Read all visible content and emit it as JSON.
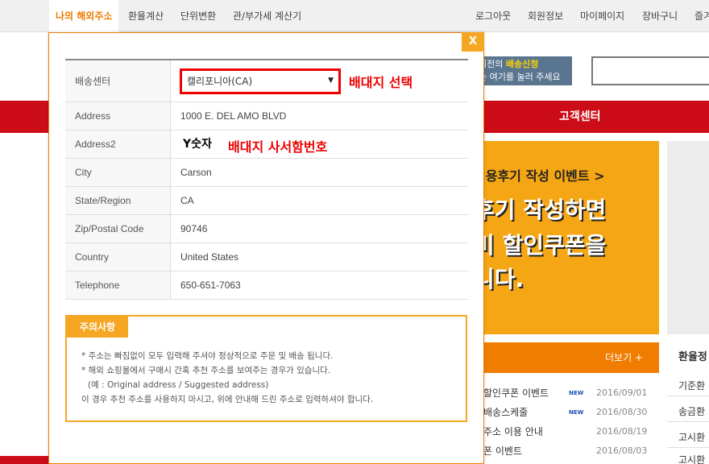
{
  "nav": {
    "items": [
      "나의 해외주소",
      "환율계산",
      "단위변환",
      "관/부가세 계산기"
    ],
    "right": [
      "로그아웃",
      "회원정보",
      "마이페이지",
      "장바구니",
      "즐겨"
    ]
  },
  "background": {
    "prev_order_line1_pre": "이전의 ",
    "prev_order_line1_hl": "배송신청",
    "prev_order_line2": "는 여기를 눌러 주세요",
    "customer_center": "고객센터",
    "banner_title": "이용후기 작성 이벤트 >",
    "banner_big": [
      "후기 작성하면",
      "비 할인쿠폰을",
      "니다."
    ],
    "more": "더보기 +",
    "rate_title": "환율정",
    "news": [
      {
        "title": "할인쿠폰 이벤트",
        "new": "NEW",
        "date": "2016/09/01"
      },
      {
        "title": "배송스케줄",
        "new": "NEW",
        "date": "2016/08/30"
      },
      {
        "title": "주소 이용 안내",
        "new": "",
        "date": "2016/08/19"
      },
      {
        "title": "폰 이벤트",
        "new": "",
        "date": "2016/08/03"
      }
    ],
    "rates": [
      "기준환",
      "송금환",
      "고시환",
      "고시환"
    ]
  },
  "modal": {
    "close_label": "X",
    "fields": [
      {
        "label": "배송센터",
        "value": "캘리포니아(CA)"
      },
      {
        "label": "Address",
        "value": "1000 E. DEL AMO BLVD"
      },
      {
        "label": "Address2",
        "value": "Y숫자"
      },
      {
        "label": "City",
        "value": "Carson"
      },
      {
        "label": "State/Region",
        "value": "CA"
      },
      {
        "label": "Zip/Postal Code",
        "value": "90746"
      },
      {
        "label": "Country",
        "value": "United States"
      },
      {
        "label": "Telephone",
        "value": "650-651-7063"
      }
    ],
    "select_note": "배대지 선택",
    "pobox_note": "배대지 사서함번호",
    "caution": {
      "title": "주의사항",
      "lines": [
        "* 주소는 빠짐없이 모두 입력해 주셔야 정상적으로 주문 및 배송 됩니다.",
        "* 해외 쇼핑몰에서 구매시 간혹 추천 주소를 보여주는 경우가 있습니다.",
        "(예 : Original address / Suggested address)",
        "이 경우 추천 주소를 사용하지 마시고, 위에 안내해 드린 주소로 입력하셔야 합니다."
      ]
    }
  }
}
